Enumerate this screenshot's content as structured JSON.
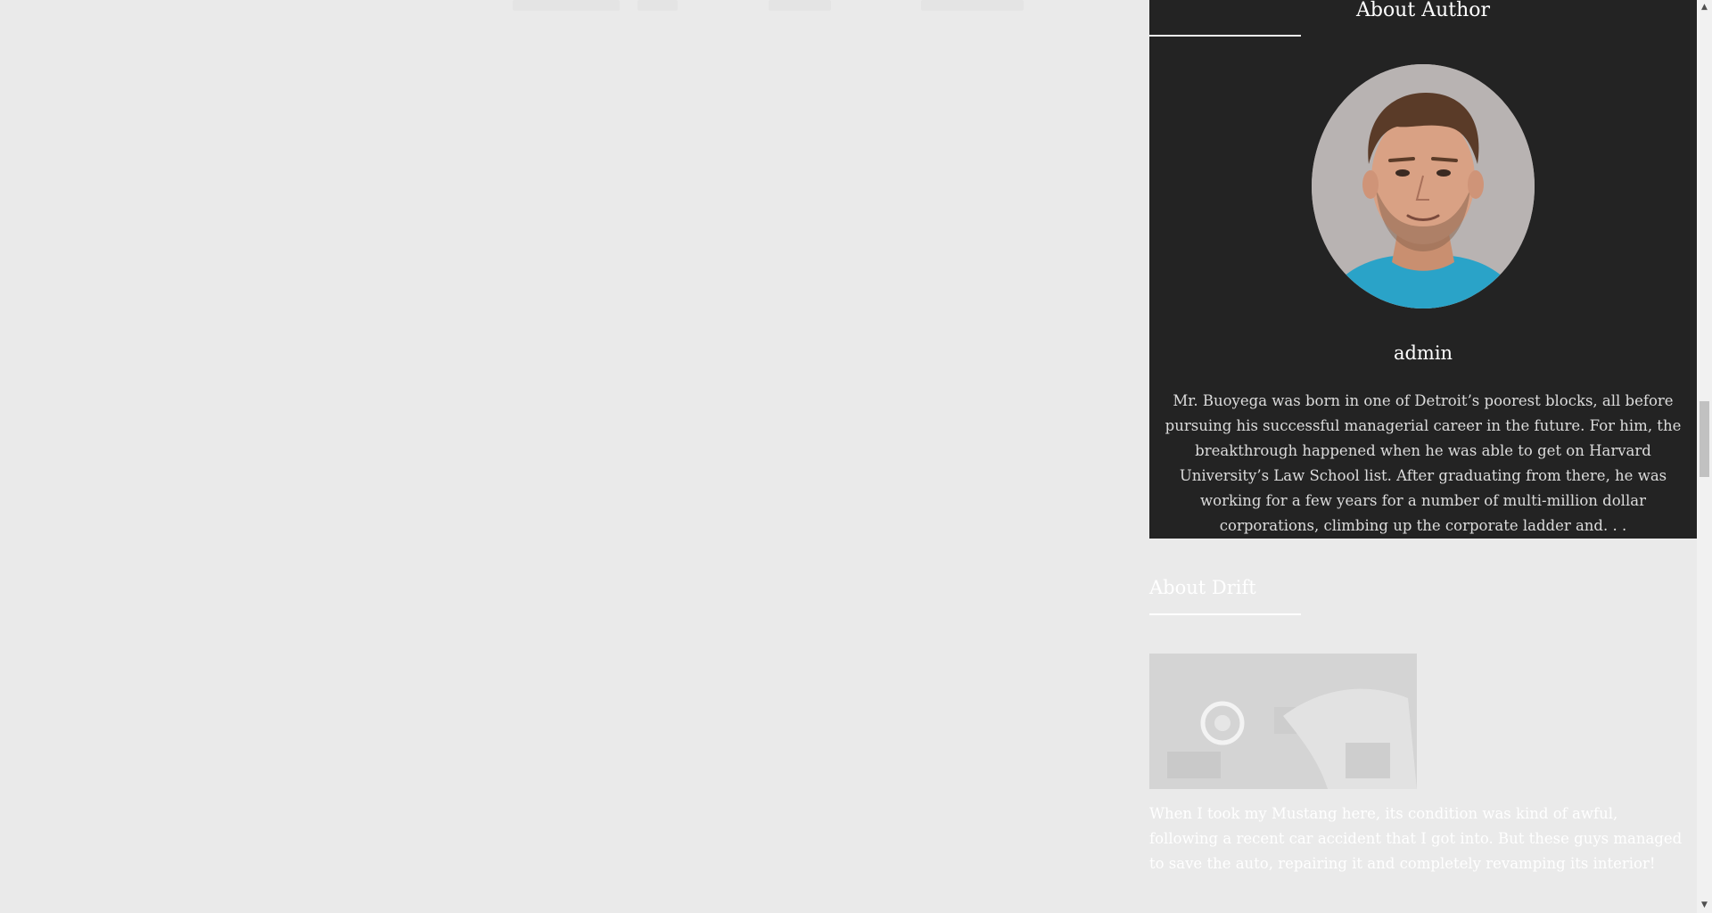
{
  "sidebar": {
    "about_author": {
      "title": "About Author",
      "name": "admin",
      "bio": "Mr. Buoyega was born in one of Detroit’s poorest blocks, all before pursuing his successful managerial career in the future. For him, the breakthrough happened when he was able to get on Harvard University’s Law School list. After graduating from there, he was working for a few years for a number of multi-million dollar corporations, climbing up the corporate ladder and. . ."
    },
    "about_drift": {
      "title": "About Drift",
      "text": "When I took my Mustang here, its condition was kind of awful, following a recent car accident that I got into. But these guys managed to save the auto, repairing it and completely revamping its interior!"
    }
  },
  "colors": {
    "page_background": "#eaeaea",
    "widget_background": "#232323",
    "accent_text": "#ffffff"
  },
  "icons": {
    "scroll_up": "triangle-up-icon",
    "scroll_down": "triangle-down-icon"
  }
}
